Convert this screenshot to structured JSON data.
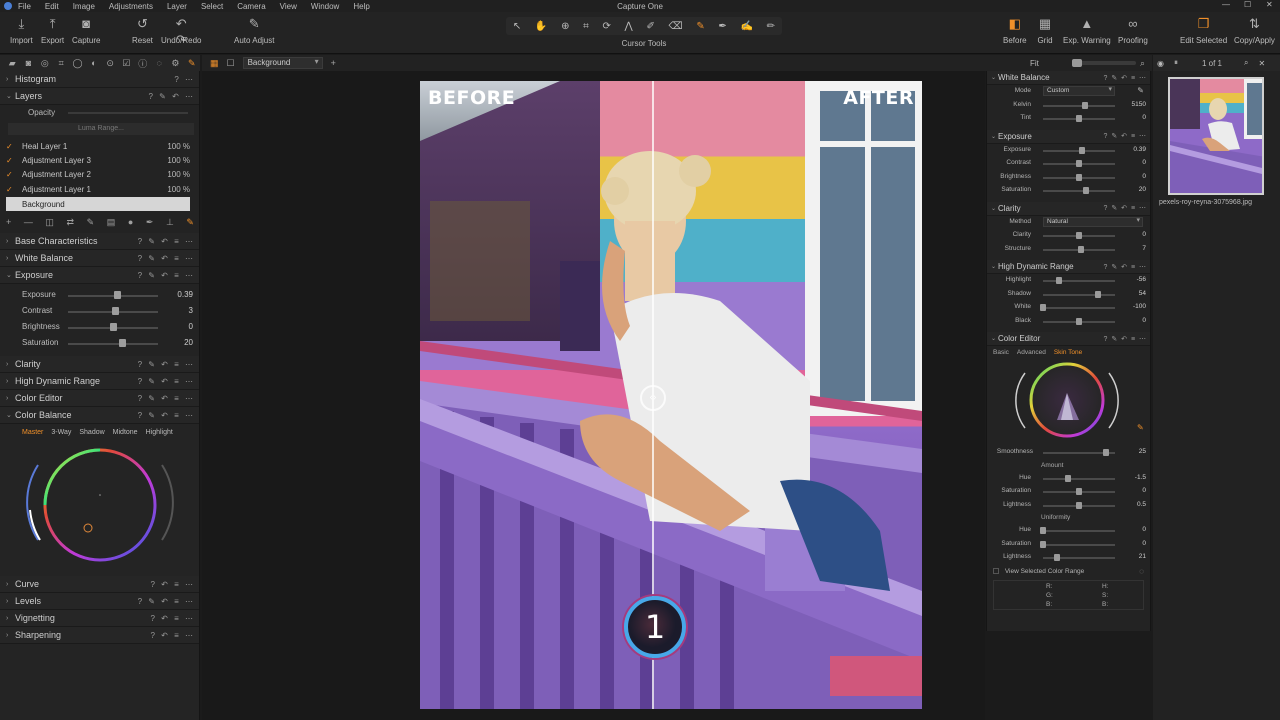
{
  "menu": {
    "app_title": "Capture One",
    "items": [
      "File",
      "Edit",
      "Image",
      "Adjustments",
      "Layer",
      "Select",
      "Camera",
      "View",
      "Window",
      "Help"
    ]
  },
  "toolbar": {
    "import": "Import",
    "export": "Export",
    "capture": "Capture",
    "reset": "Reset",
    "undo_redo": "Undo/Redo",
    "auto_adjust": "Auto Adjust",
    "cursor_tools": "Cursor Tools",
    "before": "Before",
    "grid": "Grid",
    "exp_warning": "Exp. Warning",
    "proofing": "Proofing",
    "edit_selected": "Edit Selected",
    "copy_apply": "Copy/Apply"
  },
  "viewer": {
    "variant": "Background",
    "fit": "Fit",
    "before_label": "BEFORE",
    "after_label": "AFTER",
    "badge": "1"
  },
  "browser": {
    "counter": "1 of 1",
    "filename": "pexels-roy-reyna-3075968.jpg"
  },
  "left": {
    "histogram": "Histogram",
    "layers": {
      "title": "Layers",
      "opacity_label": "Opacity",
      "luma_range": "Luma Range...",
      "rows": [
        {
          "name": "Heal Layer 1",
          "pct": "100 %"
        },
        {
          "name": "Adjustment Layer 3",
          "pct": "100 %"
        },
        {
          "name": "Adjustment Layer 2",
          "pct": "100 %"
        },
        {
          "name": "Adjustment Layer 1",
          "pct": "100 %"
        }
      ],
      "background": "Background"
    },
    "base_characteristics": "Base Characteristics",
    "white_balance": "White Balance",
    "exposure": {
      "title": "Exposure",
      "rows": [
        {
          "label": "Exposure",
          "value": "0.39",
          "pos": 0.54
        },
        {
          "label": "Contrast",
          "value": "3",
          "pos": 0.52
        },
        {
          "label": "Brightness",
          "value": "0",
          "pos": 0.5
        },
        {
          "label": "Saturation",
          "value": "20",
          "pos": 0.6
        }
      ]
    },
    "clarity": "Clarity",
    "hdr": "High Dynamic Range",
    "color_editor": "Color Editor",
    "color_balance": {
      "title": "Color Balance",
      "tabs": [
        "Master",
        "3-Way",
        "Shadow",
        "Midtone",
        "Highlight"
      ]
    },
    "curve": "Curve",
    "levels": "Levels",
    "vignetting": "Vignetting",
    "sharpening": "Sharpening"
  },
  "right": {
    "white_balance": {
      "title": "White Balance",
      "mode_label": "Mode",
      "mode_value": "Custom",
      "rows": [
        {
          "label": "Kelvin",
          "value": "5150",
          "pos": 0.58
        },
        {
          "label": "Tint",
          "value": "0",
          "pos": 0.5
        }
      ]
    },
    "exposure": {
      "title": "Exposure",
      "rows": [
        {
          "label": "Exposure",
          "value": "0.39",
          "pos": 0.54
        },
        {
          "label": "Contrast",
          "value": "0",
          "pos": 0.5
        },
        {
          "label": "Brightness",
          "value": "0",
          "pos": 0.5
        },
        {
          "label": "Saturation",
          "value": "20",
          "pos": 0.6
        }
      ]
    },
    "clarity": {
      "title": "Clarity",
      "method_label": "Method",
      "method_value": "Natural",
      "rows": [
        {
          "label": "Clarity",
          "value": "0",
          "pos": 0.5
        },
        {
          "label": "Structure",
          "value": "7",
          "pos": 0.53
        }
      ]
    },
    "hdr": {
      "title": "High Dynamic Range",
      "rows": [
        {
          "label": "Highlight",
          "value": "-56",
          "pos": 0.22
        },
        {
          "label": "Shadow",
          "value": "54",
          "pos": 0.77
        },
        {
          "label": "White",
          "value": "-100",
          "pos": 0.0
        },
        {
          "label": "Black",
          "value": "0",
          "pos": 0.5
        }
      ]
    },
    "color_editor": {
      "title": "Color Editor",
      "tabs": [
        "Basic",
        "Advanced",
        "Skin Tone"
      ],
      "smoothness_label": "Smoothness",
      "smoothness_value": "25",
      "smoothness_pos": 0.88,
      "amount_label": "Amount",
      "amount_rows": [
        {
          "label": "Hue",
          "value": "-1.5",
          "pos": 0.35
        },
        {
          "label": "Saturation",
          "value": "0",
          "pos": 0.5
        },
        {
          "label": "Lightness",
          "value": "0.5",
          "pos": 0.5
        }
      ],
      "uniformity_label": "Uniformity",
      "uniformity_rows": [
        {
          "label": "Hue",
          "value": "0",
          "pos": 0.0
        },
        {
          "label": "Saturation",
          "value": "0",
          "pos": 0.0
        },
        {
          "label": "Lightness",
          "value": "21",
          "pos": 0.2
        }
      ],
      "view_range": "View Selected Color Range",
      "readout": {
        "r": "R:",
        "g": "G:",
        "b": "B:",
        "h": "H:",
        "s": "S:",
        "b2": "B:"
      }
    }
  }
}
